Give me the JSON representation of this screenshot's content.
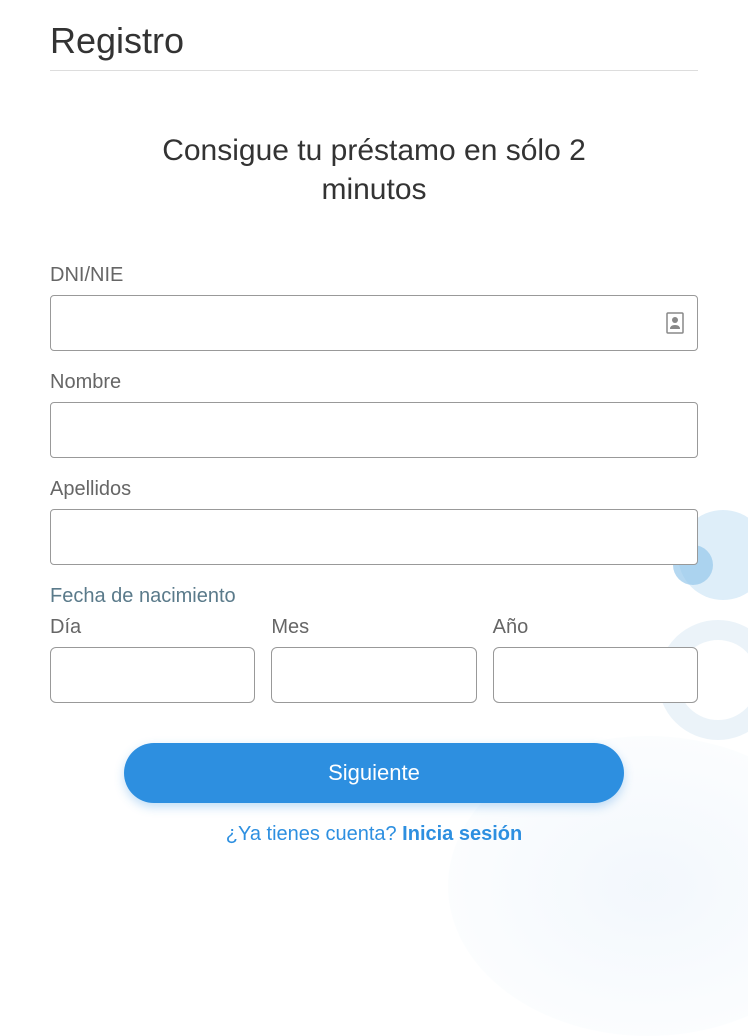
{
  "page": {
    "title": "Registro",
    "subtitle": "Consigue tu préstamo en sólo 2 minutos"
  },
  "form": {
    "dni": {
      "label": "DNI/NIE",
      "value": ""
    },
    "nombre": {
      "label": "Nombre",
      "value": ""
    },
    "apellidos": {
      "label": "Apellidos",
      "value": ""
    },
    "fecha": {
      "section_label": "Fecha de nacimiento",
      "dia": {
        "label": "Día",
        "value": ""
      },
      "mes": {
        "label": "Mes",
        "value": ""
      },
      "ano": {
        "label": "Año",
        "value": ""
      }
    },
    "submit_label": "Siguiente"
  },
  "footer": {
    "prompt": "¿Ya tienes cuenta? ",
    "link": "Inicia sesión"
  }
}
